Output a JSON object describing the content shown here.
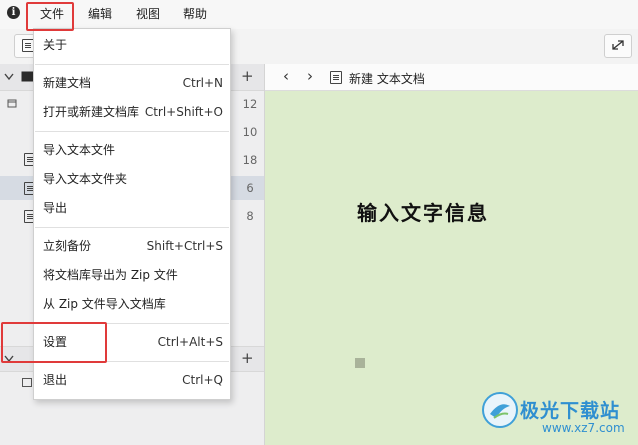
{
  "menubar": {
    "info_icon": "i",
    "items": [
      "文件",
      "编辑",
      "视图",
      "帮助"
    ]
  },
  "sidebar": {
    "add_symbol": "+",
    "counts": [
      "12",
      "10",
      "18",
      "6",
      "8"
    ]
  },
  "nav": {
    "back_symbol": "‹",
    "forward_symbol": "›",
    "doc_title": "新建 文本文档"
  },
  "editor": {
    "content": "输入文字信息"
  },
  "file_menu": {
    "about": "关于",
    "new_doc": "新建文档",
    "new_doc_shortcut": "Ctrl+N",
    "open_lib": "打开或新建文档库",
    "open_lib_shortcut": "Ctrl+Shift+O",
    "import_file": "导入文本文件",
    "import_folder": "导入文本文件夹",
    "export": "导出",
    "backup": "立刻备份",
    "backup_shortcut": "Shift+Ctrl+S",
    "export_zip": "将文档库导出为 Zip 文件",
    "import_zip": "从 Zip 文件导入文档库",
    "settings": "设置",
    "settings_shortcut": "Ctrl+Alt+S",
    "quit": "退出",
    "quit_shortcut": "Ctrl+Q"
  },
  "watermark": {
    "name": "极光下载站",
    "url": "www.xz7.com"
  },
  "colors": {
    "editor_bg": "#ddeccc",
    "highlight": "#e03a3a",
    "watermark": "#2f8fd0"
  }
}
